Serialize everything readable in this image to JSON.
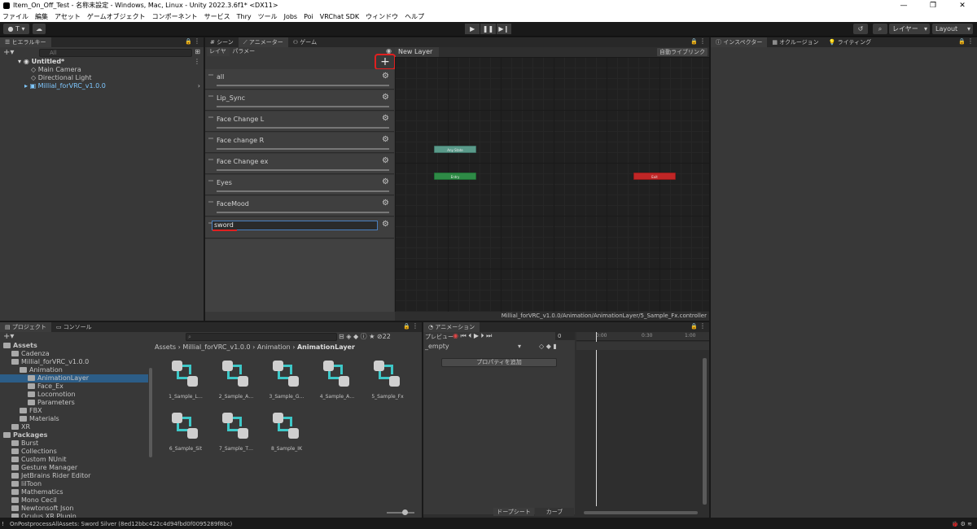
{
  "window": {
    "title": "Item_On_Off_Test - 名称未設定 - Windows, Mac, Linux - Unity 2022.3.6f1* <DX11>",
    "min": "—",
    "max": "❐",
    "close": "✕"
  },
  "menu": [
    "ファイル",
    "編集",
    "アセット",
    "ゲームオブジェクト",
    "コンポーネント",
    "サービス",
    "Thry",
    "ツール",
    "Jobs",
    "Poi",
    "VRChat SDK",
    "ウィンドウ",
    "ヘルプ"
  ],
  "toolbar": {
    "account": "T",
    "layers": "レイヤー",
    "layout": "Layout",
    "play": "▶",
    "pause": "❚❚",
    "step": "▶❙"
  },
  "hierarchy": {
    "tab": "ヒエラルキー",
    "search_placeholder": "All",
    "scene": "Untitled*",
    "items": [
      "Main Camera",
      "Directional Light",
      "Millial_forVRC_v1.0.0"
    ]
  },
  "center_tabs": [
    "シーン",
    "アニメーター",
    "ゲーム"
  ],
  "animator": {
    "sub_tabs": [
      "レイヤー",
      "パラメーター"
    ],
    "breadcrumb": "New Layer",
    "auto_live": "自動ライブリンク",
    "add_button": "+",
    "layers": [
      "all",
      "Lip_Sync",
      "Face Change L",
      "Face change R",
      "Face Change ex",
      "Eyes",
      "FaceMood"
    ],
    "rename_value": "sword",
    "states": {
      "any": "Any State",
      "entry": "Entry",
      "exit": "Exit"
    },
    "path": "Millial_forVRC_v1.0.0/Animation/AnimationLayer/5_Sample_Fx.controller"
  },
  "inspector_tabs": [
    "インスペクター",
    "オクルージョン",
    "ライティング"
  ],
  "project": {
    "tabs": [
      "プロジェクト",
      "コンソール"
    ],
    "hidden_count": "22",
    "breadcrumb": [
      "Assets",
      "Millial_forVRC_v1.0.0",
      "Animation",
      "AnimationLayer"
    ],
    "tree": [
      {
        "label": "Assets",
        "indent": 0,
        "bold": true
      },
      {
        "label": "Cadenza",
        "indent": 1
      },
      {
        "label": "Millial_forVRC_v1.0.0",
        "indent": 1
      },
      {
        "label": "Animation",
        "indent": 2
      },
      {
        "label": "AnimationLayer",
        "indent": 3,
        "selected": true
      },
      {
        "label": "Face_Ex",
        "indent": 3
      },
      {
        "label": "Locomotion",
        "indent": 3
      },
      {
        "label": "Parameters",
        "indent": 3
      },
      {
        "label": "FBX",
        "indent": 2
      },
      {
        "label": "Materials",
        "indent": 2
      },
      {
        "label": "XR",
        "indent": 1
      },
      {
        "label": "Packages",
        "indent": 0,
        "bold": true
      },
      {
        "label": "Burst",
        "indent": 1
      },
      {
        "label": "Collections",
        "indent": 1
      },
      {
        "label": "Custom NUnit",
        "indent": 1
      },
      {
        "label": "Gesture Manager",
        "indent": 1
      },
      {
        "label": "JetBrains Rider Editor",
        "indent": 1
      },
      {
        "label": "lilToon",
        "indent": 1
      },
      {
        "label": "Mathematics",
        "indent": 1
      },
      {
        "label": "Mono Cecil",
        "indent": 1
      },
      {
        "label": "Newtonsoft Json",
        "indent": 1
      },
      {
        "label": "Oculus XR Plugin",
        "indent": 1
      }
    ],
    "assets": [
      "1_Sample_L…",
      "2_Sample_A…",
      "3_Sample_G…",
      "4_Sample_A…",
      "5_Sample_Fx",
      "6_Sample_Sit",
      "7_Sample_T…",
      "8_Sample_IK"
    ]
  },
  "animation": {
    "tab": "アニメーション",
    "preview": "プレビュー",
    "frame": "0",
    "clip": "_empty",
    "add_property": "プロパティを追加",
    "dopesheet": "ドープシート",
    "curves": "カーブ",
    "time_marks": [
      "0:00",
      "0:30",
      "1:00"
    ]
  },
  "status": {
    "message": "OnPostprocessAllAssets: Sword Silver (8ed12bbc422c4d94fbd0f0095289f8bc)"
  },
  "colors": {
    "highlight_red": "#e02020",
    "anystate": "#5a9a8a",
    "entry": "#2e8b46",
    "exit": "#c02626",
    "selection": "#2c5d87"
  }
}
